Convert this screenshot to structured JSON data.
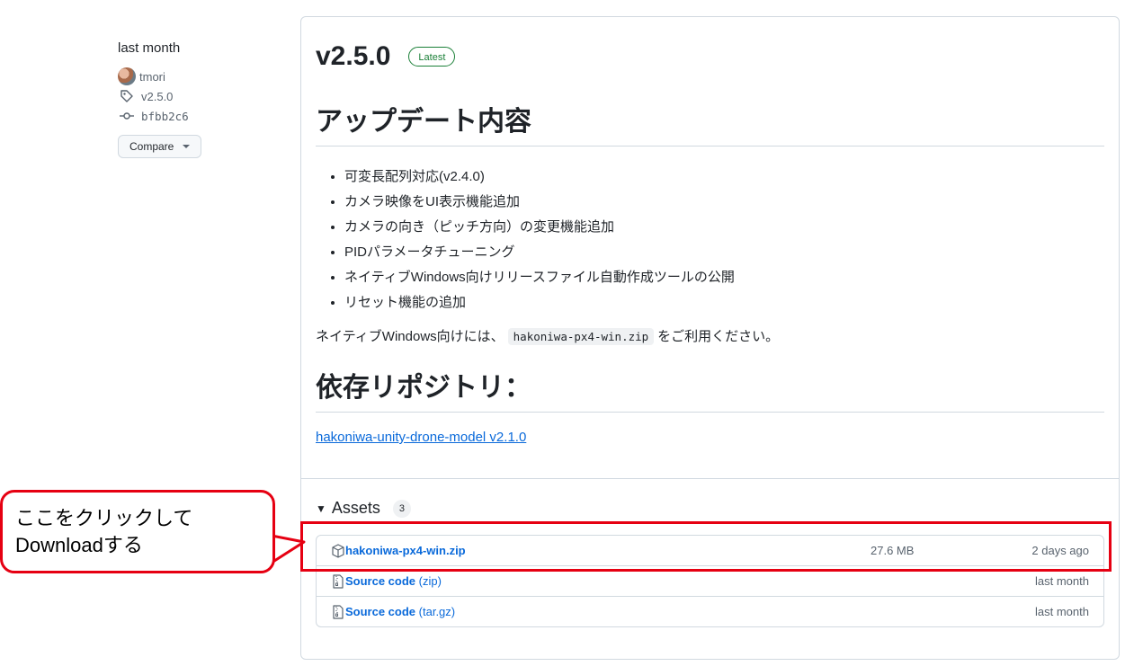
{
  "sidebar": {
    "date": "last month",
    "author": "tmori",
    "tag": "v2.5.0",
    "commit": "bfbb2c6",
    "compare_label": "Compare"
  },
  "release": {
    "title": "v2.5.0",
    "badge": "Latest",
    "update_heading": "アップデート内容",
    "changes": [
      "可変長配列対応(v2.4.0)",
      "カメラ映像をUI表示機能追加",
      "カメラの向き（ピッチ方向）の変更機能追加",
      "PIDパラメータチューニング",
      "ネイティブWindows向けリリースファイル自動作成ツールの公開",
      "リセット機能の追加"
    ],
    "note_prefix": "ネイティブWindows向けには、",
    "note_code": "hakoniwa-px4-win.zip",
    "note_suffix": "をご利用ください。",
    "deps_heading": "依存リポジトリ：",
    "dep_link": "hakoniwa-unity-drone-model v2.1.0"
  },
  "assets": {
    "title": "Assets",
    "count": "3",
    "items": [
      {
        "name": "hakoniwa-px4-win.zip",
        "suffix": "",
        "size": "27.6 MB",
        "date": "2 days ago",
        "icon": "package-icon"
      },
      {
        "name": "Source code",
        "suffix": "(zip)",
        "size": "",
        "date": "last month",
        "icon": "file-zip-icon"
      },
      {
        "name": "Source code",
        "suffix": "(tar.gz)",
        "size": "",
        "date": "last month",
        "icon": "file-zip-icon"
      }
    ]
  },
  "callout": {
    "line1": "ここをクリックして",
    "line2": "Downloadする"
  },
  "colors": {
    "accent_link": "#0969da",
    "latest_green": "#1a7f37",
    "annotation_red": "#e60012"
  }
}
